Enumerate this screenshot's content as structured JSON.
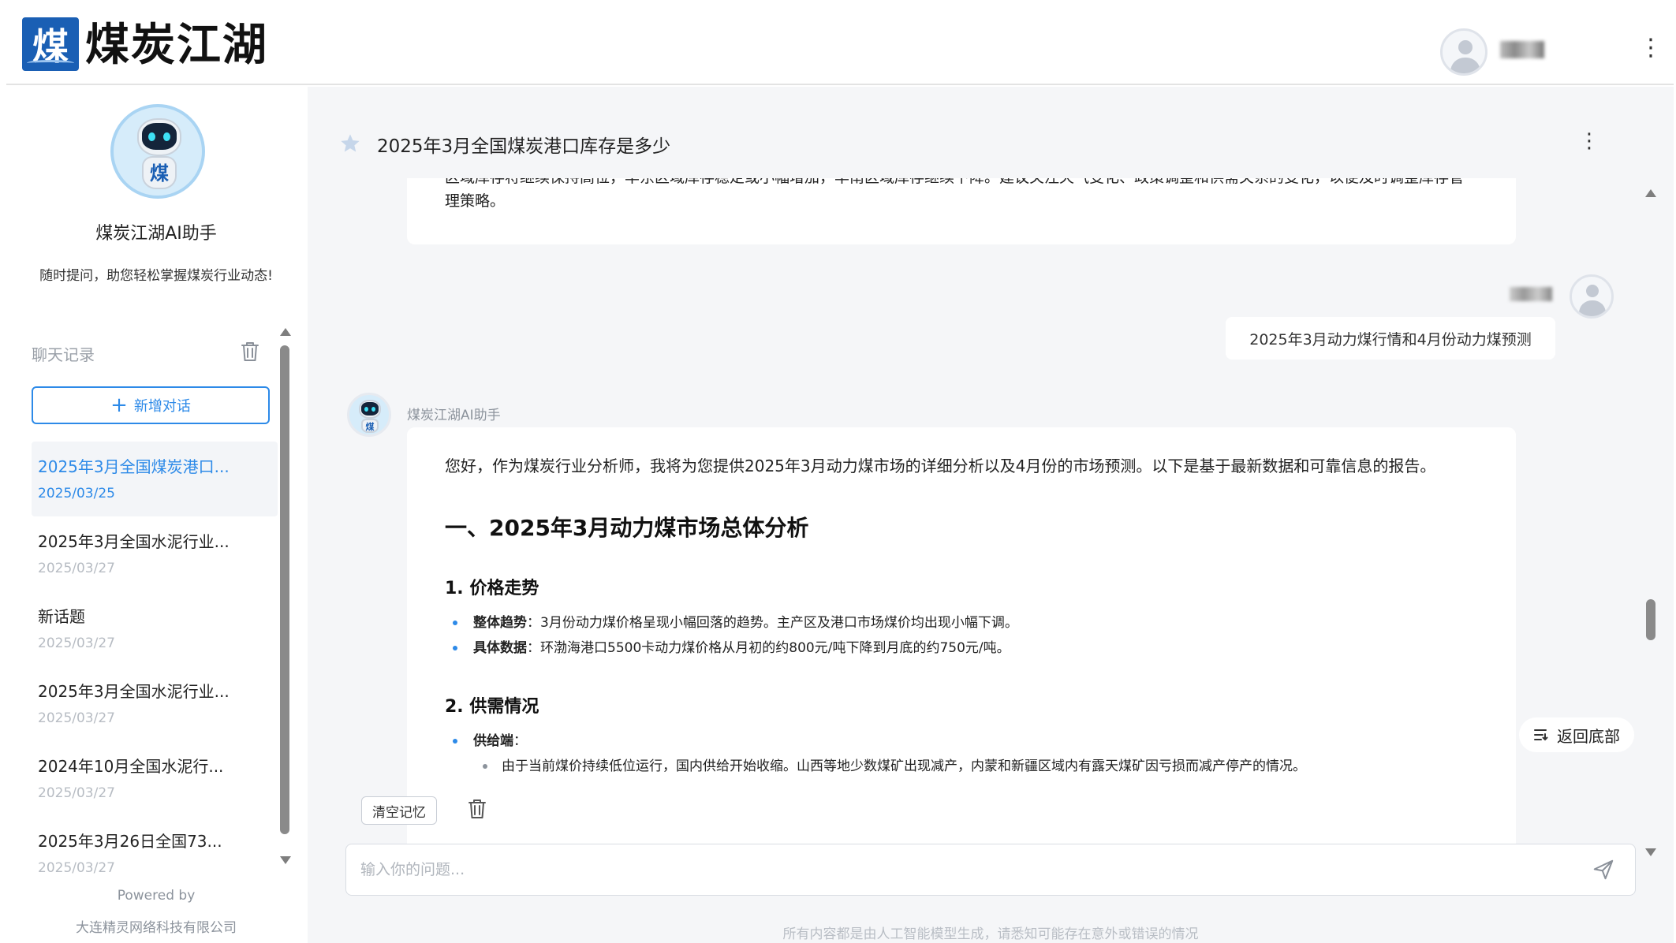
{
  "header": {
    "logo_char": "煤",
    "brand": "煤炭江湖",
    "username": "****",
    "more": "⋮"
  },
  "sidebar": {
    "assistant_name": "煤炭江湖AI助手",
    "assistant_desc": "随时提问，助您轻松掌握煤炭行业动态!",
    "history_label": "聊天记录",
    "new_chat_label": "新增对话",
    "history": [
      {
        "title": "2025年3月全国煤炭港口...",
        "date": "2025/03/25",
        "active": true
      },
      {
        "title": "2025年3月全国水泥行业...",
        "date": "2025/03/27"
      },
      {
        "title": "新话题",
        "date": "2025/03/27"
      },
      {
        "title": "2025年3月全国水泥行业...",
        "date": "2025/03/27"
      },
      {
        "title": "2024年10月全国水泥行...",
        "date": "2025/03/27"
      },
      {
        "title": "2025年3月26日全国73...",
        "date": "2025/03/27"
      }
    ],
    "powered_by": "Powered by",
    "company": "大连精灵网络科技有限公司"
  },
  "main": {
    "title": "2025年3月全国煤炭港口库存是多少",
    "more": "⋮",
    "prev_answer_tail": "区域库存将继续保持高位，华东区域库存稳定或小幅增加，华南区域库存继续下降。建议关注天气变化、政策调整和供需关系的变化，以便及时调整库存管理策略。",
    "user_name": "****",
    "user_question": "2025年3月动力煤行情和4月份动力煤预测",
    "bot_name": "煤炭江湖AI助手",
    "answer": {
      "intro": "您好，作为煤炭行业分析师，我将为您提供2025年3月动力煤市场的详细分析以及4月份的市场预测。以下是基于最新数据和可靠信息的报告。",
      "h1": "一、2025年3月动力煤市场总体分析",
      "sec1_title": "1. 价格走势",
      "sec1_items": [
        {
          "label": "整体趋势",
          "text": "：3月份动力煤价格呈现小幅回落的趋势。主产区及港口市场煤价均出现小幅下调。"
        },
        {
          "label": "具体数据",
          "text": "：环渤海港口5500卡动力煤价格从月初的约800元/吨下降到月底的约750元/吨。"
        }
      ],
      "sec2_title": "2. 供需情况",
      "sec2_items": [
        {
          "label": "供给端",
          "text": "："
        }
      ],
      "sec2_sub": [
        "由于当前煤价持续低位运行，国内供给开始收缩。山西等地少数煤矿出现减产，内蒙和新疆区域内有露天煤矿因亏损而减产停产的情况。"
      ]
    },
    "back_to_bottom": "返回底部",
    "clear_memory": "清空记忆",
    "input_placeholder": "输入你的问题...",
    "disclaimer": "所有内容都是由人工智能模型生成，请悉知可能存在意外或错误的情况"
  },
  "colors": {
    "accent": "#2d8ae8",
    "brand_blue": "#1a5fb4",
    "muted": "#b7bcc3",
    "main_bg": "#f5f6f8"
  }
}
